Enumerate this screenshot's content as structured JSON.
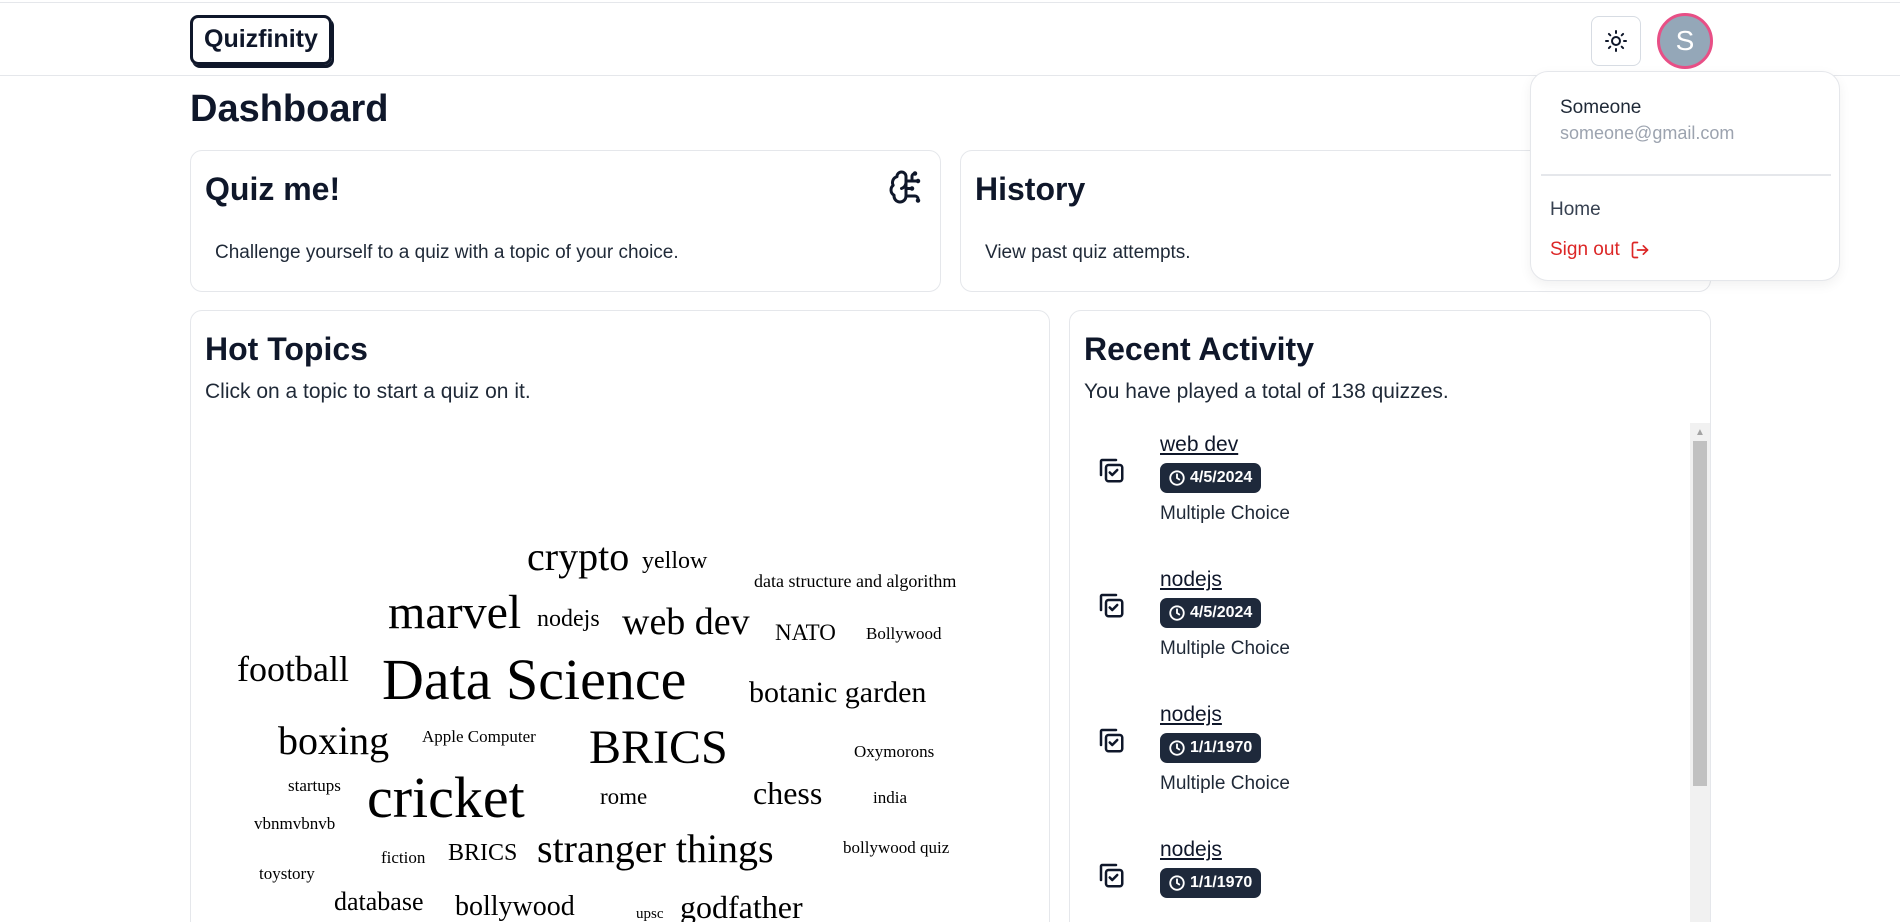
{
  "header": {
    "logo": "Quizfinity",
    "theme_icon": "sun-icon",
    "avatar_initial": "S",
    "avatar_border_color": "#e84f86"
  },
  "page": {
    "title": "Dashboard"
  },
  "quiz_card": {
    "title": "Quiz me!",
    "description": "Challenge yourself to a quiz with a topic of your choice.",
    "icon": "brain-circuit-icon"
  },
  "history_card": {
    "title": "History",
    "description": "View past quiz attempts."
  },
  "hot_topics": {
    "title": "Hot Topics",
    "subtitle": "Click on a topic to start a quiz on it.",
    "words": [
      "crypto",
      "yellow",
      "data structure and algorithm",
      "marvel",
      "nodejs",
      "web dev",
      "NATO",
      "Bollywood",
      "football",
      "Data Science",
      "botanic garden",
      "boxing",
      "Apple Computer",
      "BRICS",
      "Oxymorons",
      "startups",
      "cricket",
      "rome",
      "chess",
      "india",
      "vbnmvbnvb",
      "fiction",
      "BRICS",
      "stranger things",
      "bollywood quiz",
      "toystory",
      "database",
      "bollywood",
      "upsc",
      "godfather"
    ]
  },
  "recent_activity": {
    "title": "Recent Activity",
    "subtitle": "You have played a total of 138 quizzes.",
    "items": [
      {
        "topic": "web dev",
        "date": "4/5/2024",
        "type": "Multiple Choice"
      },
      {
        "topic": "nodejs",
        "date": "4/5/2024",
        "type": "Multiple Choice"
      },
      {
        "topic": "nodejs",
        "date": "1/1/1970",
        "type": "Multiple Choice"
      },
      {
        "topic": "nodejs",
        "date": "1/1/1970",
        "type": ""
      }
    ]
  },
  "user_menu": {
    "name": "Someone",
    "email": "someone@gmail.com",
    "home_label": "Home",
    "signout_label": "Sign out",
    "signout_color": "#dc2626"
  }
}
